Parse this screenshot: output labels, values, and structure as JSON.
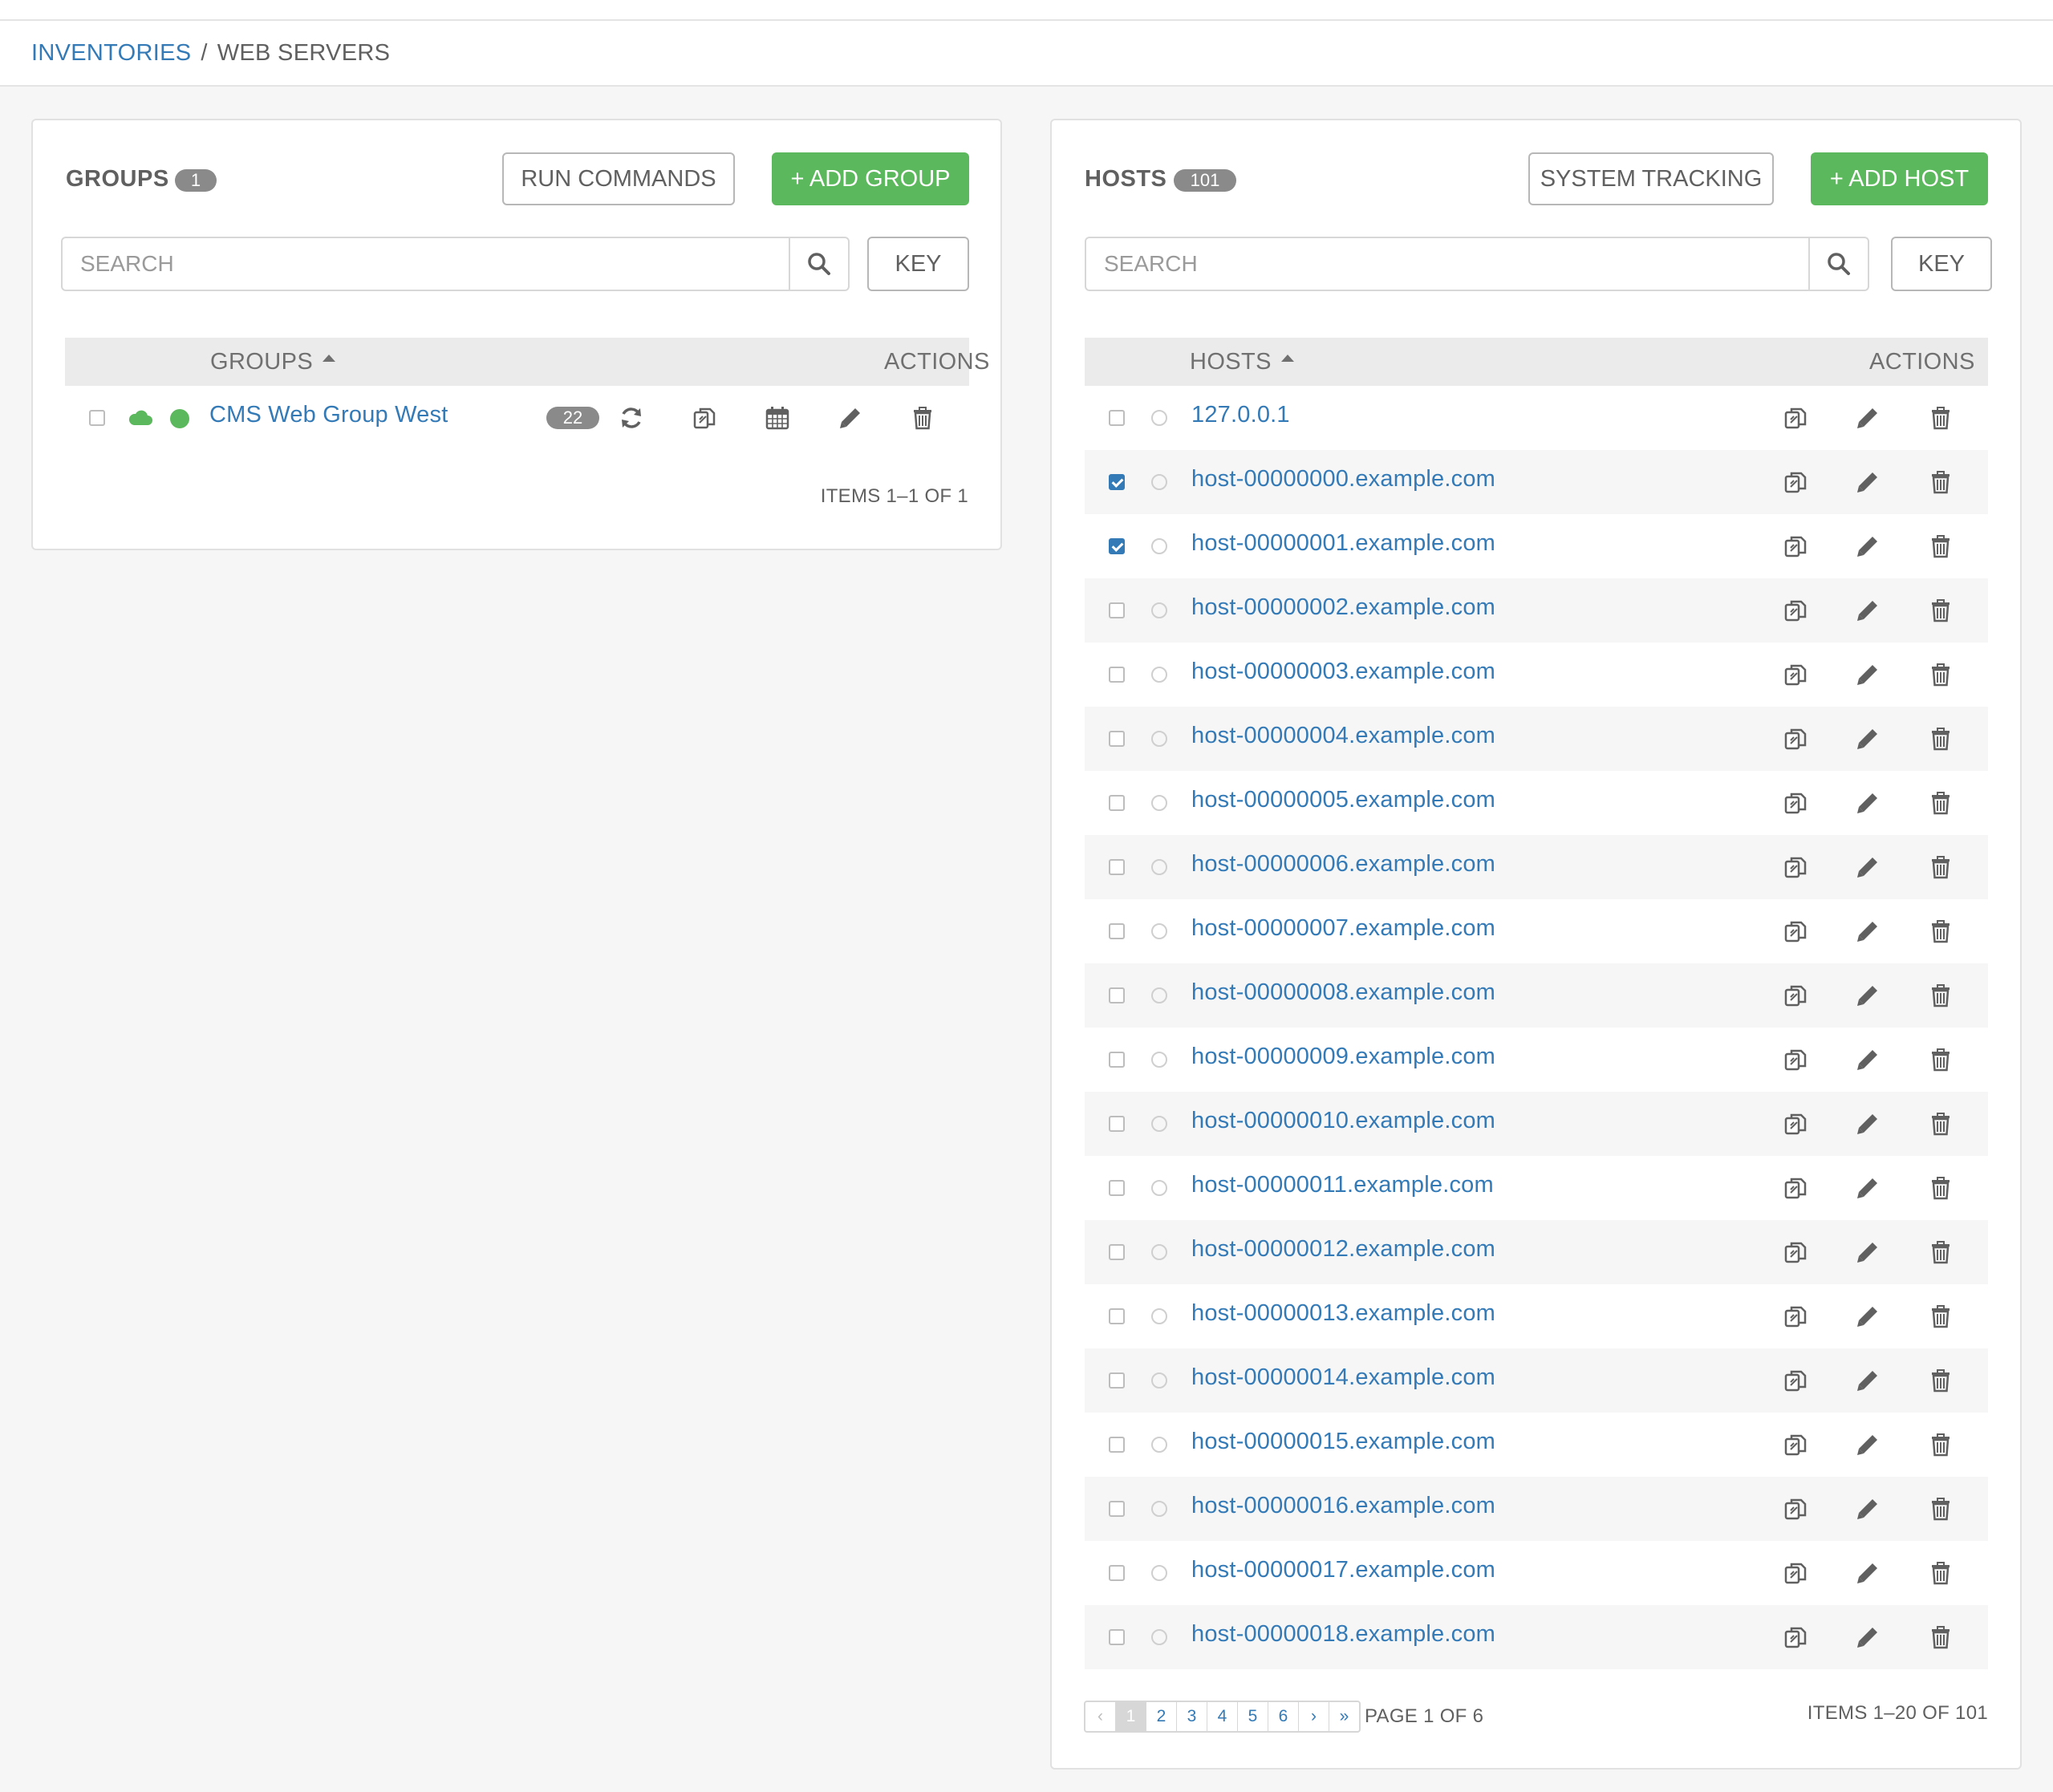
{
  "breadcrumb": {
    "parent": "INVENTORIES",
    "separator": "/",
    "current": "WEB SERVERS"
  },
  "groups_panel": {
    "title": "GROUPS",
    "count": "1",
    "run_commands_label": "RUN COMMANDS",
    "add_label": "+ ADD GROUP",
    "search_placeholder": "SEARCH",
    "key_label": "KEY",
    "col_name": "GROUPS",
    "col_actions": "ACTIONS",
    "rows": [
      {
        "name": "CMS Web Group West",
        "host_count": "22",
        "cloud_color": "#5cb85c",
        "status_color": "#5cb85c"
      }
    ],
    "items_label": "ITEMS 1–1 OF 1"
  },
  "hosts_panel": {
    "title": "HOSTS",
    "count": "101",
    "system_tracking_label": "SYSTEM TRACKING",
    "add_label": "+ ADD HOST",
    "search_placeholder": "SEARCH",
    "key_label": "KEY",
    "col_name": "HOSTS",
    "col_actions": "ACTIONS",
    "rows": [
      {
        "name": "127.0.0.1",
        "checked": false
      },
      {
        "name": "host-00000000.example.com",
        "checked": true
      },
      {
        "name": "host-00000001.example.com",
        "checked": true
      },
      {
        "name": "host-00000002.example.com",
        "checked": false
      },
      {
        "name": "host-00000003.example.com",
        "checked": false
      },
      {
        "name": "host-00000004.example.com",
        "checked": false
      },
      {
        "name": "host-00000005.example.com",
        "checked": false
      },
      {
        "name": "host-00000006.example.com",
        "checked": false
      },
      {
        "name": "host-00000007.example.com",
        "checked": false
      },
      {
        "name": "host-00000008.example.com",
        "checked": false
      },
      {
        "name": "host-00000009.example.com",
        "checked": false
      },
      {
        "name": "host-00000010.example.com",
        "checked": false
      },
      {
        "name": "host-00000011.example.com",
        "checked": false
      },
      {
        "name": "host-00000012.example.com",
        "checked": false
      },
      {
        "name": "host-00000013.example.com",
        "checked": false
      },
      {
        "name": "host-00000014.example.com",
        "checked": false
      },
      {
        "name": "host-00000015.example.com",
        "checked": false
      },
      {
        "name": "host-00000016.example.com",
        "checked": false
      },
      {
        "name": "host-00000017.example.com",
        "checked": false
      },
      {
        "name": "host-00000018.example.com",
        "checked": false
      }
    ],
    "pagination": {
      "first": "‹",
      "pages": [
        "1",
        "2",
        "3",
        "4",
        "5",
        "6"
      ],
      "current": "1",
      "next": "›",
      "last": "»",
      "page_label": "PAGE 1 OF 6",
      "items_label": "ITEMS 1–20 OF 101"
    }
  },
  "colors": {
    "accent": "#337ab7",
    "success": "#5cb85c",
    "badge": "#8a8a8a"
  },
  "icons": {
    "search": "search-icon",
    "sync": "sync-icon",
    "copy": "copy-icon",
    "schedule": "calendar-icon",
    "edit": "pencil-icon",
    "delete": "trash-icon",
    "cloud": "cloud-icon",
    "status": "status-dot-icon"
  }
}
